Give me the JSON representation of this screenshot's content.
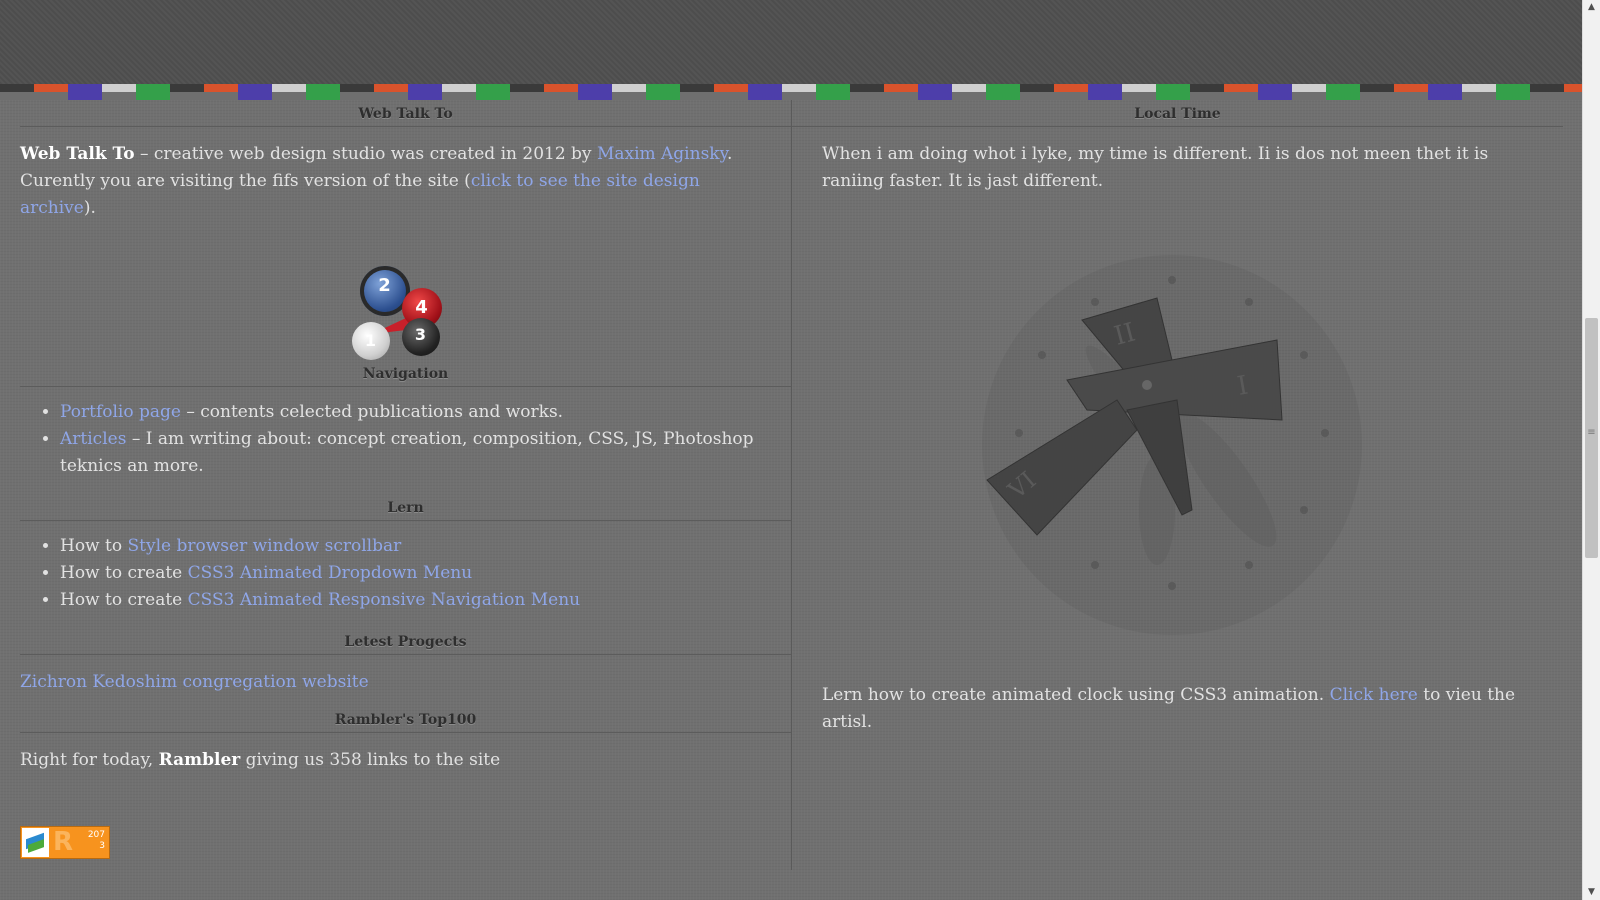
{
  "stripe_colors": [
    "#3a3a3a",
    "#d9532c",
    "#4d3eaa",
    "#cfcfcf",
    "#34a04a"
  ],
  "left": {
    "about": {
      "title": "Web Talk To",
      "brand": "Web Talk To",
      "text1": " – creative web design studio was created in 2012 by ",
      "author_link": "Maxim Aginsky",
      "text2": ". Curently you are visiting the fifs version of the site (",
      "archive_link": "click to see the site design archive",
      "text3": ")."
    },
    "logo": {
      "b1": "1",
      "b2": "2",
      "b3": "3",
      "b4": "4"
    },
    "navigation": {
      "title": "Navigation",
      "items": [
        {
          "link": "Portfolio page",
          "text": " – contents celected publications and works."
        },
        {
          "link": "Articles",
          "text": " – I am writing about: concept creation, composition, CSS, JS, Photoshop teknics an more."
        }
      ]
    },
    "learn": {
      "title": "Lern",
      "items": [
        {
          "prefix": "How to ",
          "link": "Style browser window scrollbar"
        },
        {
          "prefix": "How to create ",
          "link": "CSS3 Animated Dropdown Menu"
        },
        {
          "prefix": "How to create ",
          "link": "CSS3 Animated Responsive Navigation Menu"
        }
      ]
    },
    "projects": {
      "title": "Letest Progects",
      "link": "Zichron Kedoshim congregation website"
    },
    "rambler": {
      "title": "Rambler's Top100",
      "text1": "Right for today, ",
      "bold": "Rambler",
      "text2": " giving us 358 links to the site",
      "counter_top": "207",
      "counter_bottom": "3"
    }
  },
  "right": {
    "title": "Local Time",
    "quote": "When i am doing whot i lyke, my time is different. Ii is dos not meen thet it is raniing faster. It is jast different.",
    "clock_numerals": {
      "twelve": "II",
      "three": "I",
      "seven": "VI"
    },
    "footer_text1": "Lern how to create animated clock using CSS3 animation. ",
    "footer_link": "Click here",
    "footer_text2": " to vieu the artisl."
  },
  "scrollbar": {
    "up_arrow": "▲",
    "down_arrow": "▼",
    "grip": "≡"
  }
}
